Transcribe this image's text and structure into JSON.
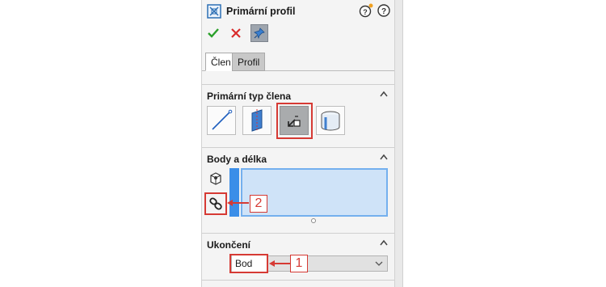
{
  "panel": {
    "title": "Primární profil",
    "tabs": [
      {
        "label": "Člen",
        "active": true
      },
      {
        "label": "Profil",
        "active": false
      }
    ],
    "sections": {
      "member_type": {
        "title": "Primární typ člena"
      },
      "points_length": {
        "title": "Body a délka"
      },
      "termination": {
        "title": "Ukončení"
      }
    },
    "termination_dropdown": {
      "value": "Bod"
    }
  },
  "callouts": [
    "1",
    "2"
  ],
  "icons": {
    "title": "structure-member-icon",
    "help": [
      "help-tips-icon",
      "help-icon"
    ],
    "actions": [
      "ok-check-icon",
      "cancel-x-icon",
      "pin-icon"
    ],
    "member_types": [
      "line-member-icon",
      "plate-member-icon",
      "point-length-member-icon",
      "cylinder-member-icon"
    ],
    "side": [
      "point-vertex-icon",
      "chain-link-icon"
    ]
  },
  "colors": {
    "highlight_red": "#d63a34",
    "selection_blue": "#3b8ee8",
    "selection_fill": "#cfe3f8",
    "ok_green": "#2aa02a",
    "cancel_red": "#d92b2b"
  }
}
